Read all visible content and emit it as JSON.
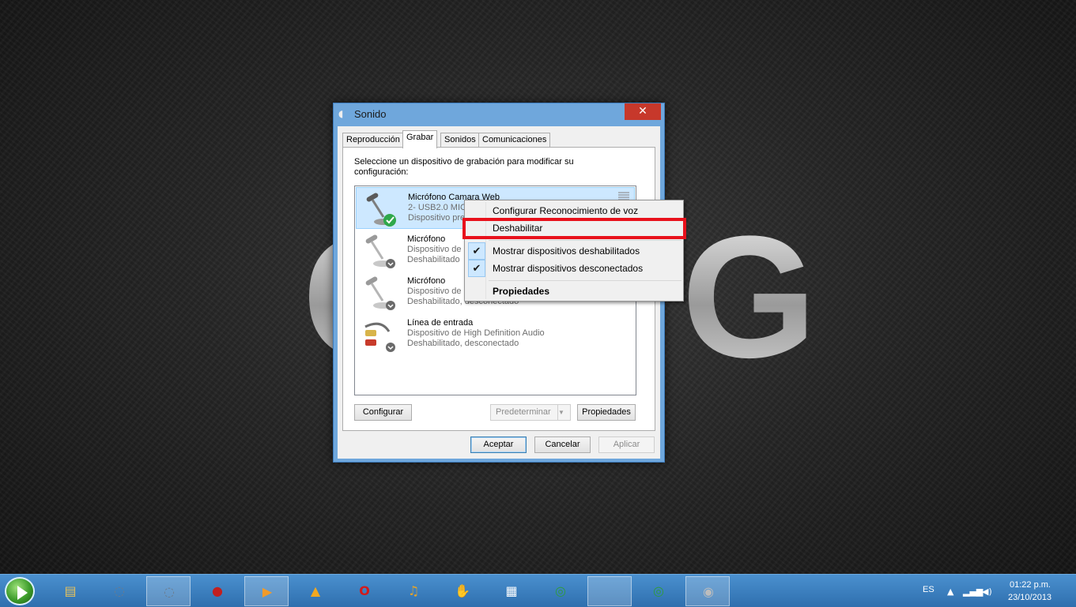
{
  "desktop": {
    "logo_left": "C",
    "logo_right": "G"
  },
  "dialog": {
    "title": "Sonido",
    "close_glyph": "✕",
    "tabs": [
      {
        "label": "Reproducción"
      },
      {
        "label": "Grabar"
      },
      {
        "label": "Sonidos"
      },
      {
        "label": "Comunicaciones"
      }
    ],
    "active_tab": "Grabar",
    "instructions": "Seleccione un dispositivo de grabación para modificar su configuración:",
    "devices": [
      {
        "name": "Micrófono Camara Web",
        "line1": "2- USB2.0 MIC",
        "line2": "Dispositivo pre",
        "status": "default"
      },
      {
        "name": "Micrófono",
        "line1": "Dispositivo de",
        "line2": "Deshabilitado",
        "status": "disabled"
      },
      {
        "name": "Micrófono",
        "line1": "Dispositivo de",
        "line2": "Deshabilitado, desconectado",
        "status": "disabled"
      },
      {
        "name": "Línea de entrada",
        "line1": "Dispositivo de High Definition Audio",
        "line2": "Deshabilitado, desconectado",
        "status": "disabled"
      }
    ],
    "buttons": {
      "configure": "Configurar",
      "set_default": "Predeterminar",
      "properties": "Propiedades",
      "ok": "Aceptar",
      "cancel": "Cancelar",
      "apply": "Aplicar"
    }
  },
  "context_menu": {
    "items": [
      {
        "label": "Configurar Reconocimiento de voz",
        "checked": false
      },
      {
        "label": "Deshabilitar",
        "checked": false,
        "highlighted": true
      },
      {
        "label": "Mostrar dispositivos deshabilitados",
        "checked": true
      },
      {
        "label": "Mostrar dispositivos desconectados",
        "checked": true
      },
      {
        "label": "Propiedades",
        "checked": false,
        "bold": true
      }
    ],
    "check_glyph": "✔"
  },
  "taskbar": {
    "apps": [
      {
        "icon": "file-explorer-icon",
        "glyph": "▤",
        "color": "#e8c25a"
      },
      {
        "icon": "app-ring-icon",
        "glyph": "◌",
        "color": "#6b7b8c"
      },
      {
        "icon": "app-ring-icon-active",
        "glyph": "◌",
        "color": "#6b7b8c"
      },
      {
        "icon": "paint-icon",
        "glyph": "●",
        "color": "#c21f1f"
      },
      {
        "icon": "media-player-icon",
        "glyph": "▶",
        "color": "#f29b2a"
      },
      {
        "icon": "aimp-icon",
        "glyph": "▲",
        "color": "#f3a820"
      },
      {
        "icon": "opera-icon",
        "glyph": "O",
        "color": "#d41a1a"
      },
      {
        "icon": "music-icon",
        "glyph": "♫",
        "color": "#e3a32a"
      },
      {
        "icon": "glove-icon",
        "glyph": "✋",
        "color": "#c9662c"
      },
      {
        "icon": "grid-app-icon",
        "glyph": "▦",
        "color": "#ffffff"
      },
      {
        "icon": "chrome-icon",
        "glyph": "◎",
        "color": "#2f9b3f"
      },
      {
        "icon": "blank-window-icon",
        "glyph": "",
        "color": "#8fb3d6"
      },
      {
        "icon": "chrome-icon-2",
        "glyph": "◎",
        "color": "#2f9b3f"
      },
      {
        "icon": "speaker-icon",
        "glyph": "◉",
        "color": "#bdbdbd"
      }
    ],
    "language": "ES",
    "time": "01:22 p.m.",
    "date": "23/10/2013"
  }
}
